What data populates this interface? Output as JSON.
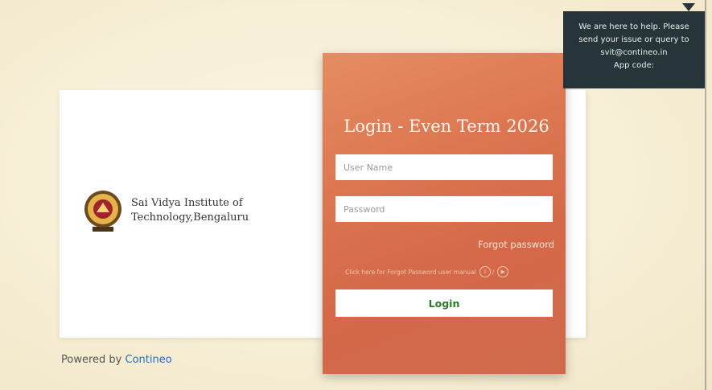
{
  "org": {
    "name_line1": "Sai Vidya Institute of",
    "name_line2": "Technology,Bengaluru",
    "logo_icon": "college-seal-icon"
  },
  "login": {
    "title": "Login - Even Term 2026",
    "username_placeholder": "User Name",
    "password_placeholder": "Password",
    "forgot_label": "Forgot password",
    "manual_text": "Click here for Forgot Password user manual",
    "login_button": "Login"
  },
  "footer": {
    "powered_prefix": "Powered by",
    "powered_brand": "Contineo"
  },
  "help": {
    "line1": "We are here to help. Please",
    "line2": "send your issue or query to",
    "line3": "svit@contineo.in",
    "line4": "App code:"
  },
  "colors": {
    "panel": "#d46848",
    "brand": "#1e6fb8",
    "login_text": "#2a7a2a",
    "tooltip_bg": "#27353a"
  }
}
